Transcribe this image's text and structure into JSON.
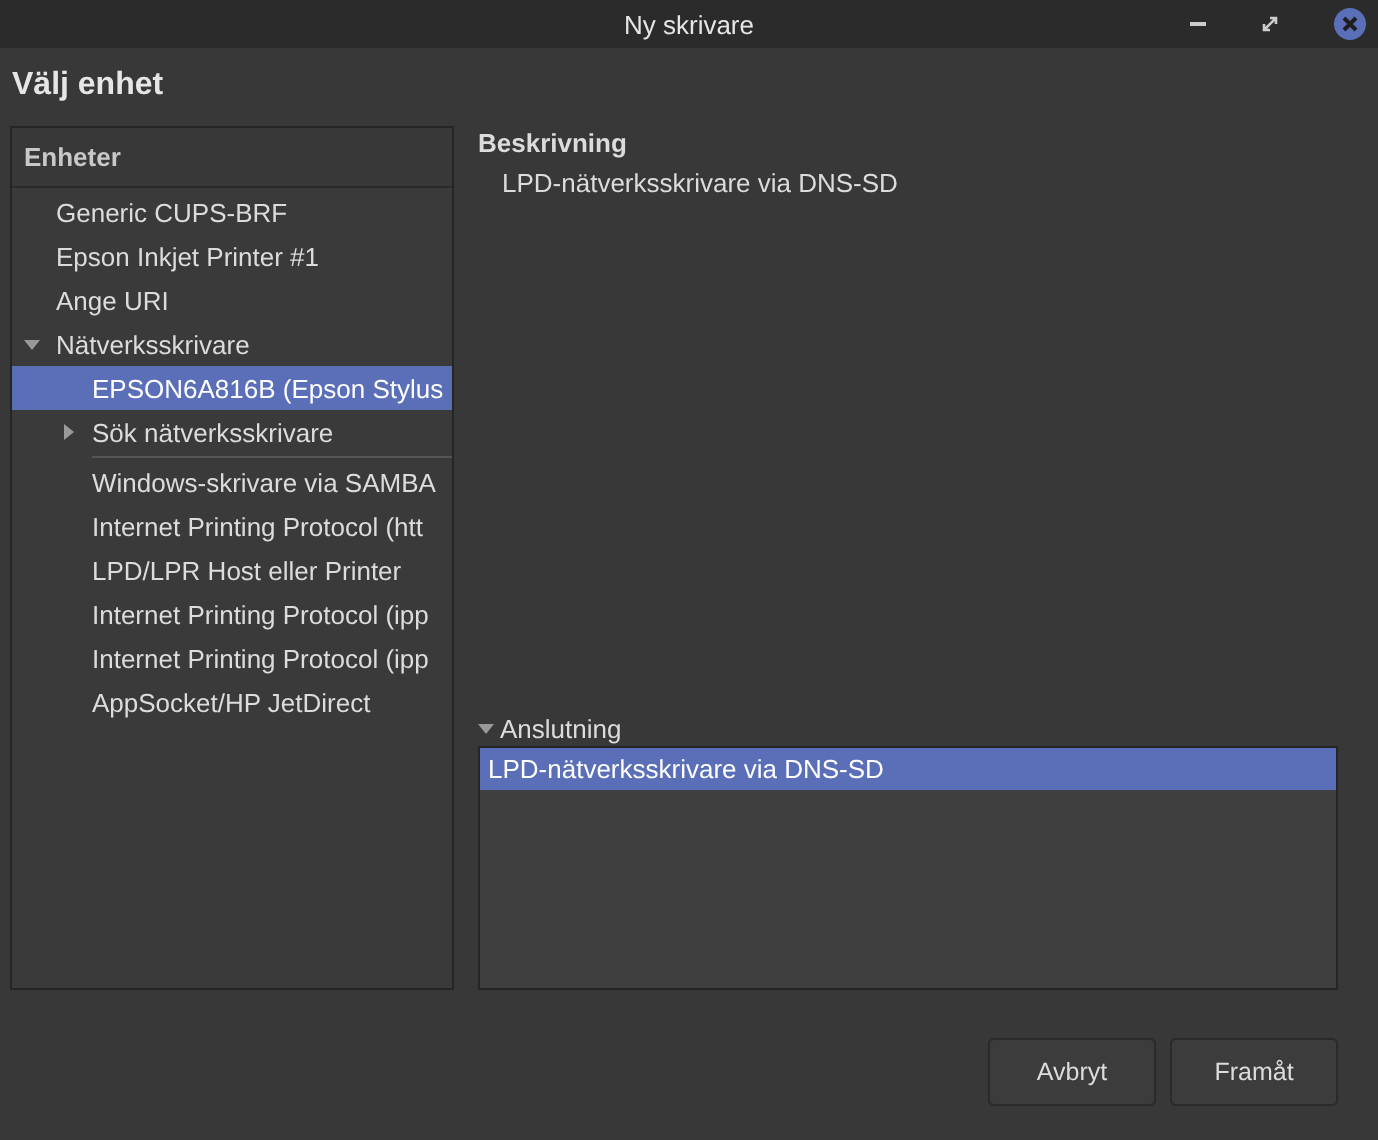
{
  "window": {
    "title": "Ny skrivare"
  },
  "heading": "Välj enhet",
  "devices": {
    "header": "Enheter",
    "items": [
      {
        "kind": "item",
        "label": "Generic CUPS-BRF",
        "selected": false
      },
      {
        "kind": "item",
        "label": "Epson Inkjet Printer #1",
        "selected": false
      },
      {
        "kind": "item",
        "label": "Ange URI",
        "selected": false
      },
      {
        "kind": "item",
        "label": "Nätverksskrivare",
        "selected": false,
        "expanded": true,
        "children": [
          {
            "kind": "item",
            "label": "EPSON6A816B (Epson Stylus",
            "selected": true
          },
          {
            "kind": "item",
            "label": "Sök nätverksskrivare",
            "selected": false,
            "expanded": false
          },
          {
            "kind": "separator"
          },
          {
            "kind": "item",
            "label": "Windows-skrivare via SAMBA",
            "selected": false
          },
          {
            "kind": "item",
            "label": "Internet Printing Protocol (htt",
            "selected": false
          },
          {
            "kind": "item",
            "label": "LPD/LPR Host eller Printer",
            "selected": false
          },
          {
            "kind": "item",
            "label": "Internet Printing Protocol (ipp",
            "selected": false
          },
          {
            "kind": "item",
            "label": "Internet Printing Protocol (ipp",
            "selected": false
          },
          {
            "kind": "item",
            "label": "AppSocket/HP JetDirect",
            "selected": false
          }
        ]
      }
    ]
  },
  "description": {
    "title": "Beskrivning",
    "text": "LPD-nätverksskrivare via DNS-SD"
  },
  "connection": {
    "label": "Anslutning",
    "expanded": true,
    "items": [
      {
        "label": "LPD-nätverksskrivare via DNS-SD",
        "selected": true
      }
    ]
  },
  "buttons": [
    "Avbryt",
    "Framåt"
  ]
}
